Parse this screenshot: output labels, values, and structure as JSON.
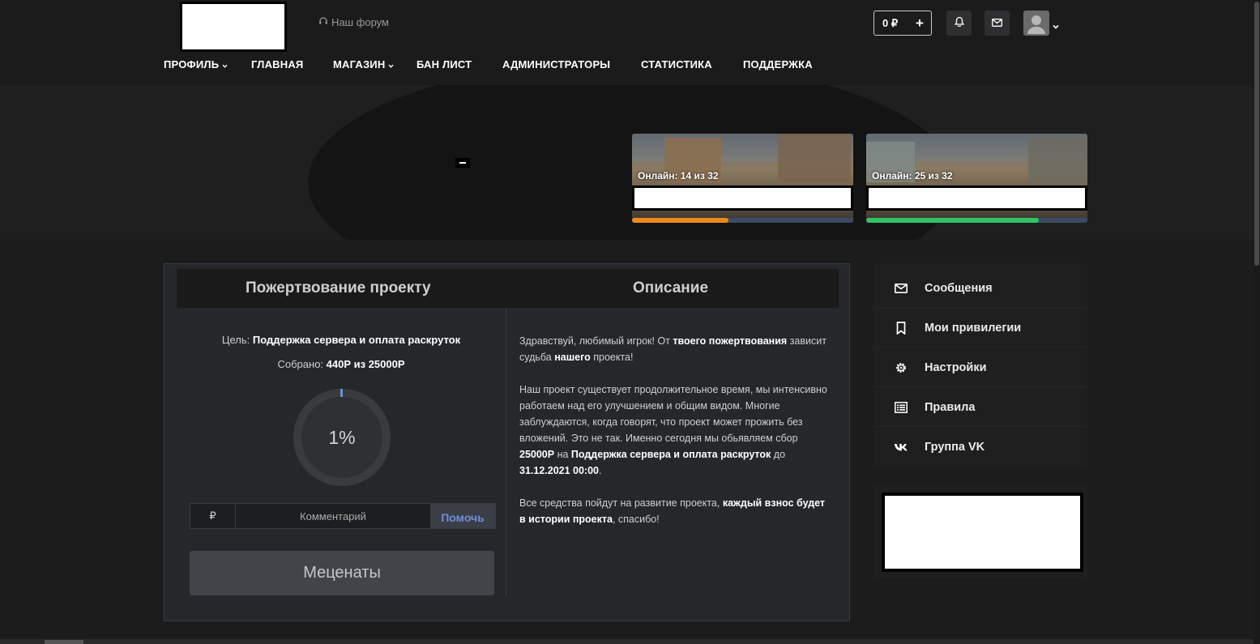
{
  "header": {
    "forum_link": "Наш форум",
    "balance": "0 ₽",
    "balance_add": "+",
    "icons": [
      "bell-icon",
      "mail-icon",
      "user-avatar-icon"
    ]
  },
  "nav": {
    "items": [
      {
        "label": "ПРОФИЛЬ",
        "dropdown": true
      },
      {
        "label": "ГЛАВНАЯ",
        "dropdown": false
      },
      {
        "label": "МАГАЗИН",
        "dropdown": true
      },
      {
        "label": "БАН ЛИСТ",
        "dropdown": false
      },
      {
        "label": "АДМИНИСТРАТОРЫ",
        "dropdown": false
      },
      {
        "label": "СТАТИСТИКА",
        "dropdown": false
      },
      {
        "label": "ПОДДЕРЖКА",
        "dropdown": false
      }
    ]
  },
  "servers": [
    {
      "online": "Онлайн: 14 из 32",
      "fill": 0.4375,
      "color": "#f08a1c"
    },
    {
      "online": "Онлайн: 25 из 32",
      "fill": 0.78125,
      "color": "#2fc463"
    }
  ],
  "donation": {
    "title": "Пожертвование проекту",
    "desc_title": "Описание",
    "goal_label": "Цель:",
    "goal_value": "Поддержка сервера и оплата раскруток",
    "collected_label": "Собрано:",
    "collected_value": "440Р из 25000Р",
    "percent": "1%",
    "percent_value": 0.0176,
    "currency": "₽",
    "comment_placeholder": "Комментарий",
    "help_button": "Помочь",
    "patrons_button": "Меценаты",
    "description": {
      "p1_a": "Здравствуй, любимый игрок! От ",
      "p1_b": "твоего пожертвования",
      "p1_c": " зависит судьба ",
      "p1_d": "нашего",
      "p1_e": " проекта!",
      "p2_a": "Наш проект существует продолжительное время, мы интенсивно работаем над его улучшением и общим видом. Многие заблуждаются, когда говорят, что проект может прожить без вложений. Это не так. Именно сегодня мы обьявляем сбор ",
      "p2_b": "25000Р",
      "p2_c": " на ",
      "p2_d": "Поддержка сервера и оплата раскруток",
      "p2_e": " до ",
      "p2_f": "31.12.2021 00:00",
      "p2_g": ".",
      "p3_a": "Все средства пойдут на развитие проекта, ",
      "p3_b": "каждый взнос будет в истории проекта",
      "p3_c": ", спасибо!"
    }
  },
  "sidebar": {
    "items": [
      {
        "label": "Сообщения",
        "icon": "envelope-icon"
      },
      {
        "label": "Мои привилегии",
        "icon": "bookmark-icon"
      },
      {
        "label": "Настройки",
        "icon": "gear-icon"
      },
      {
        "label": "Правила",
        "icon": "list-icon"
      },
      {
        "label": "Группа VK",
        "icon": "vk-icon"
      }
    ]
  }
}
